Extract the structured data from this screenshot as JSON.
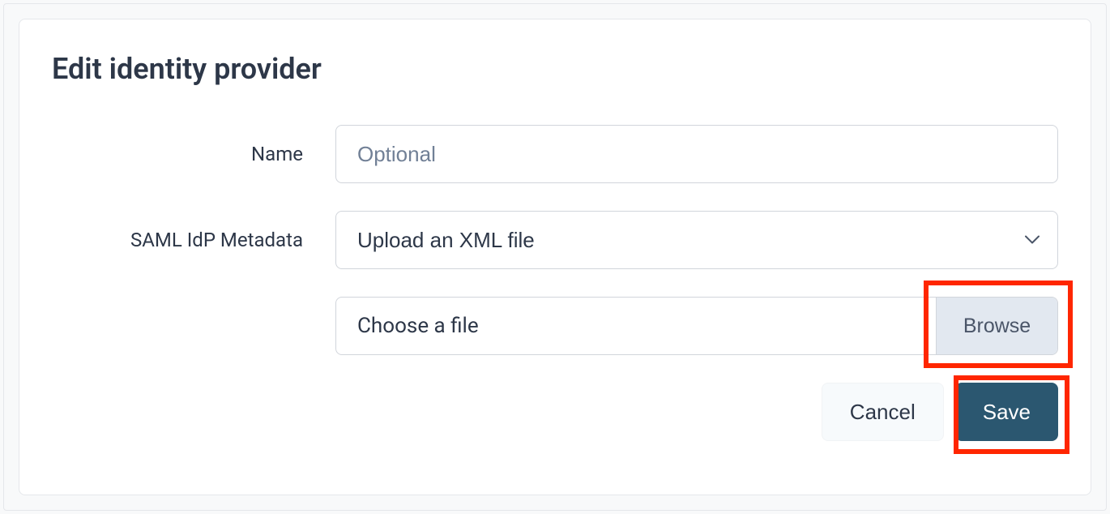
{
  "title": "Edit identity provider",
  "form": {
    "name": {
      "label": "Name",
      "placeholder": "Optional",
      "value": ""
    },
    "metadata": {
      "label": "SAML IdP Metadata",
      "selected": "Upload an XML file"
    },
    "file": {
      "placeholder": "Choose a file",
      "browse_label": "Browse"
    }
  },
  "actions": {
    "cancel_label": "Cancel",
    "save_label": "Save"
  }
}
